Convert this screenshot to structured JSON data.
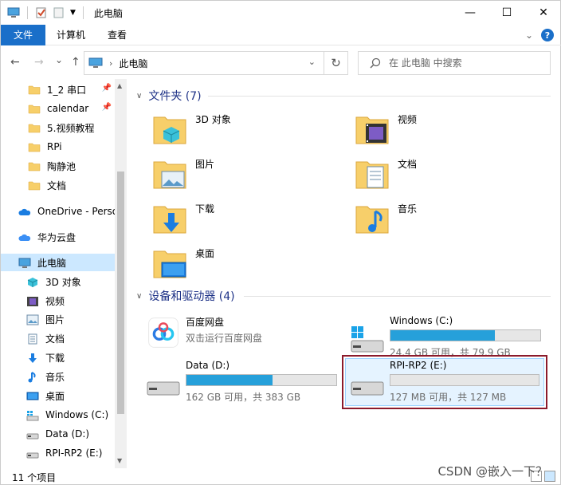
{
  "titlebar": {
    "title": "此电脑",
    "controls": {
      "minimize": "—",
      "maximize": "☐",
      "close": "✕"
    }
  },
  "ribbon": {
    "tabs": [
      "文件",
      "计算机",
      "查看"
    ],
    "expand_icon": "chevron-down-icon",
    "help_label": "?"
  },
  "nav": {
    "back": "←",
    "forward": "→",
    "recent": "⌄",
    "up": "↑",
    "path": "此电脑",
    "refresh": "↻",
    "search_placeholder": "在 此电脑 中搜索"
  },
  "sidebar": {
    "items": [
      {
        "label": "1_2 串口",
        "icon": "folder-icon",
        "pinned": true
      },
      {
        "label": "calendar",
        "icon": "folder-icon",
        "pinned": true
      },
      {
        "label": "5.视频教程",
        "icon": "folder-icon",
        "pinned": false
      },
      {
        "label": "RPi",
        "icon": "folder-icon",
        "pinned": false
      },
      {
        "label": "陶静池",
        "icon": "folder-icon",
        "pinned": false
      },
      {
        "label": "文档",
        "icon": "folder-icon",
        "pinned": false
      },
      {
        "label": "OneDrive - Perso",
        "icon": "onedrive-icon",
        "pinned": false
      },
      {
        "label": "华为云盘",
        "icon": "huawei-cloud-icon",
        "pinned": false
      },
      {
        "label": "此电脑",
        "icon": "pc-icon",
        "pinned": false,
        "selected": true
      },
      {
        "label": "3D 对象",
        "icon": "3d-objects-icon",
        "pinned": false
      },
      {
        "label": "视频",
        "icon": "video-icon",
        "pinned": false
      },
      {
        "label": "图片",
        "icon": "pictures-icon",
        "pinned": false
      },
      {
        "label": "文档",
        "icon": "documents-icon",
        "pinned": false
      },
      {
        "label": "下载",
        "icon": "download-icon",
        "pinned": false
      },
      {
        "label": "音乐",
        "icon": "music-icon",
        "pinned": false
      },
      {
        "label": "桌面",
        "icon": "desktop-icon",
        "pinned": false
      },
      {
        "label": "Windows (C:)",
        "icon": "windows-drive-icon",
        "pinned": false
      },
      {
        "label": "Data (D:)",
        "icon": "drive-icon",
        "pinned": false
      },
      {
        "label": "RPI-RP2 (E:)",
        "icon": "drive-icon",
        "pinned": false
      }
    ]
  },
  "main": {
    "folders_group": "文件夹 (7)",
    "folders": [
      {
        "label": "3D 对象",
        "icon": "3d-objects-icon"
      },
      {
        "label": "视频",
        "icon": "video-icon"
      },
      {
        "label": "图片",
        "icon": "pictures-icon"
      },
      {
        "label": "文档",
        "icon": "documents-icon"
      },
      {
        "label": "下载",
        "icon": "download-icon"
      },
      {
        "label": "音乐",
        "icon": "music-icon"
      },
      {
        "label": "桌面",
        "icon": "desktop-icon"
      }
    ],
    "devices_group": "设备和驱动器 (4)",
    "devices": [
      {
        "name": "百度网盘",
        "sub": "双击运行百度网盘",
        "icon": "baidu-netdisk-icon"
      },
      {
        "name": "Windows (C:)",
        "info": "24.4 GB 可用，共 79.9 GB",
        "used_fraction": 0.695,
        "icon": "windows-drive-icon"
      },
      {
        "name": "Data (D:)",
        "info": "162 GB 可用，共 383 GB",
        "used_fraction": 0.577,
        "icon": "drive-icon"
      },
      {
        "name": "RPI-RP2 (E:)",
        "info": "127 MB 可用，共 127 MB",
        "used_fraction": 0.0,
        "icon": "drive-icon"
      }
    ]
  },
  "status": {
    "count": "11 个项目"
  },
  "watermark": "CSDN @嵌入一下？",
  "colors": {
    "accent": "#1a6fc9",
    "selection": "#cce8ff",
    "bar_fill": "#26a0da",
    "highlight_border": "#8b1a2b"
  }
}
